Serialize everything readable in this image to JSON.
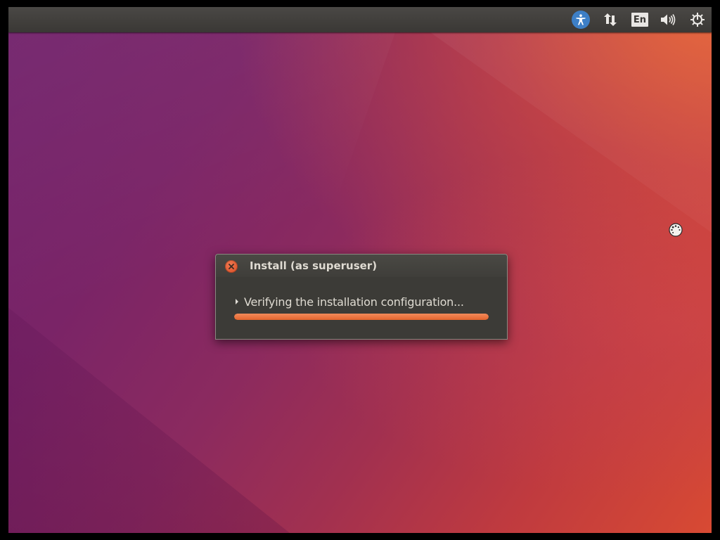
{
  "panel": {
    "indicators": [
      {
        "icon": "accessibility-icon"
      },
      {
        "icon": "network-arrows-icon"
      },
      {
        "icon": "keyboard-layout-icon",
        "label": "En"
      },
      {
        "icon": "volume-icon"
      },
      {
        "icon": "power-gear-icon"
      }
    ]
  },
  "dialog": {
    "title": "Install (as superuser)",
    "status": "Verifying the installation configuration...",
    "progress": 1.0,
    "close_icon": "close-icon"
  },
  "colors": {
    "accent": "#e3642e",
    "panel": "#3a3835",
    "dialog_bg": "#3c3b37",
    "accessibility_blue": "#3d7fc6"
  },
  "cursor": {
    "icon": "busy-spinner-icon"
  }
}
